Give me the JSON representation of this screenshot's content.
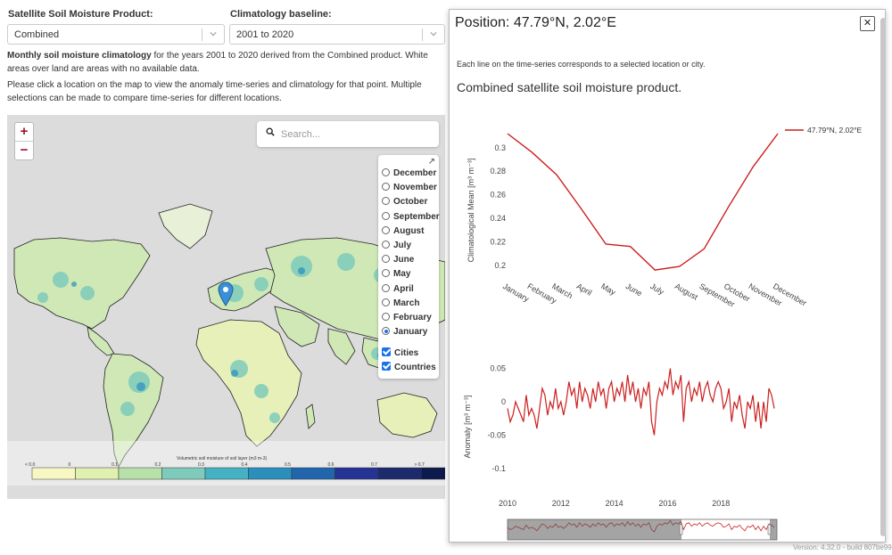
{
  "controls": {
    "product_label": "Satellite Soil Moisture Product:",
    "product_value": "Combined",
    "baseline_label": "Climatology baseline:",
    "baseline_value": "2001 to 2020"
  },
  "description": {
    "bold": "Monthly soil moisture climatology",
    "rest": " for the years 2001 to 2020 derived from the Combined product. White areas over land are areas with no available data.",
    "instructions": "Please click a location on the map to view the anomaly time-series and climatology for that point. Multiple selections can be made to compare time-series for different locations."
  },
  "map": {
    "zoom_in": "+",
    "zoom_out": "−",
    "search_placeholder": "Search...",
    "expand_icon": "↗",
    "months": [
      "December",
      "November",
      "October",
      "September",
      "August",
      "July",
      "June",
      "May",
      "April",
      "March",
      "February",
      "January"
    ],
    "selected_month": "January",
    "overlays": [
      "Cities",
      "Countries"
    ],
    "colorbar_title": "Volumetric soil moisture of soil layer (m3 m-3)",
    "colorbar_ticks": [
      "< 0.0",
      "0",
      "0.1",
      "0.2",
      "0.3",
      "0.4",
      "0.5",
      "0.6",
      "0.7",
      "> 0.7"
    ],
    "colorbar_colors": [
      "#f7f7c4",
      "#e0f0b0",
      "#b7e1a8",
      "#7fcbbb",
      "#45b2c4",
      "#2a8fbd",
      "#2166ac",
      "#253494",
      "#1c2a6e",
      "#0c1a4e"
    ],
    "land_color": "#cfe8b6",
    "ocean_color": "#dcdcdc",
    "marker_color": "#3b8fd6"
  },
  "popup": {
    "title": "Position: 47.79°N, 2.02°E",
    "close": "✕",
    "note": "Each line on the time-series corresponds to a selected location or city.",
    "chart_title": "Combined satellite soil moisture product."
  },
  "chart_data": [
    {
      "type": "line",
      "title": "",
      "ylabel": "Climatological Mean [m³ m⁻³]",
      "categories": [
        "January",
        "February",
        "March",
        "April",
        "May",
        "June",
        "July",
        "August",
        "September",
        "October",
        "November",
        "December"
      ],
      "ylim": [
        0.19,
        0.315
      ],
      "yticks": [
        0.2,
        0.22,
        0.24,
        0.26,
        0.28,
        0.3
      ],
      "series": [
        {
          "name": "47.79°N, 2.02°E",
          "color": "#cc1f1f",
          "values": [
            0.312,
            0.296,
            0.277,
            0.248,
            0.218,
            0.216,
            0.196,
            0.199,
            0.214,
            0.25,
            0.284,
            0.312
          ]
        }
      ],
      "legend": "top-right"
    },
    {
      "type": "line",
      "ylabel": "Anomaly [m³ m⁻³]",
      "x_range": [
        2010,
        2020.1
      ],
      "xticks": [
        2010,
        2012,
        2014,
        2016,
        2018
      ],
      "ylim": [
        -0.12,
        0.06
      ],
      "yticks": [
        0.05,
        0,
        -0.05,
        -0.1
      ],
      "series": [
        {
          "name": "47.79°N, 2.02°E",
          "color": "#cc1f1f",
          "x": [
            2010.0,
            2010.1,
            2010.2,
            2010.3,
            2010.4,
            2010.5,
            2010.6,
            2010.7,
            2010.8,
            2010.9,
            2011.0,
            2011.1,
            2011.2,
            2011.3,
            2011.4,
            2011.5,
            2011.6,
            2011.7,
            2011.8,
            2011.9,
            2012.0,
            2012.1,
            2012.2,
            2012.3,
            2012.4,
            2012.5,
            2012.6,
            2012.7,
            2012.8,
            2012.9,
            2013.0,
            2013.1,
            2013.2,
            2013.3,
            2013.4,
            2013.5,
            2013.6,
            2013.7,
            2013.8,
            2013.9,
            2014.0,
            2014.1,
            2014.2,
            2014.3,
            2014.4,
            2014.5,
            2014.6,
            2014.7,
            2014.8,
            2014.9,
            2015.0,
            2015.1,
            2015.2,
            2015.3,
            2015.4,
            2015.5,
            2015.6,
            2015.7,
            2015.8,
            2015.9,
            2016.0,
            2016.1,
            2016.2,
            2016.3,
            2016.4,
            2016.5,
            2016.6,
            2016.7,
            2016.8,
            2016.9,
            2017.0,
            2017.1,
            2017.2,
            2017.3,
            2017.4,
            2017.5,
            2017.6,
            2017.7,
            2017.8,
            2017.9,
            2018.0,
            2018.1,
            2018.2,
            2018.3,
            2018.4,
            2018.5,
            2018.6,
            2018.7,
            2018.8,
            2018.9,
            2019.0,
            2019.1,
            2019.2,
            2019.3,
            2019.4,
            2019.5,
            2019.6,
            2019.7,
            2019.8,
            2019.9,
            2020.0
          ],
          "values": [
            -0.01,
            -0.03,
            -0.02,
            0.0,
            -0.01,
            -0.02,
            -0.03,
            0.01,
            -0.02,
            -0.01,
            -0.02,
            -0.04,
            -0.01,
            0.02,
            0.01,
            -0.02,
            0.0,
            -0.01,
            0.02,
            -0.01,
            0.0,
            -0.02,
            0.0,
            0.03,
            0.01,
            0.02,
            -0.01,
            0.03,
            0.0,
            0.02,
            0.01,
            -0.01,
            0.02,
            0.0,
            0.03,
            0.01,
            0.02,
            -0.01,
            0.02,
            0.03,
            0.0,
            0.02,
            0.01,
            0.03,
            0.0,
            0.04,
            0.01,
            0.03,
            0.0,
            0.02,
            -0.01,
            0.02,
            0.01,
            0.03,
            -0.03,
            -0.05,
            0.0,
            0.02,
            0.01,
            0.03,
            0.02,
            0.05,
            0.01,
            0.03,
            0.02,
            0.04,
            -0.03,
            0.02,
            0.03,
            0.0,
            0.02,
            0.01,
            0.03,
            0.0,
            0.02,
            0.03,
            0.01,
            0.0,
            0.02,
            0.03,
            0.02,
            -0.01,
            0.0,
            0.02,
            -0.03,
            0.0,
            -0.01,
            0.01,
            -0.02,
            -0.04,
            0.0,
            -0.01,
            0.01,
            -0.03,
            0.0,
            -0.04,
            0.0,
            -0.03,
            0.02,
            0.01,
            -0.01
          ]
        }
      ],
      "range_slider": true
    }
  ],
  "version": "Version: 4.32.0 - build 807be99"
}
